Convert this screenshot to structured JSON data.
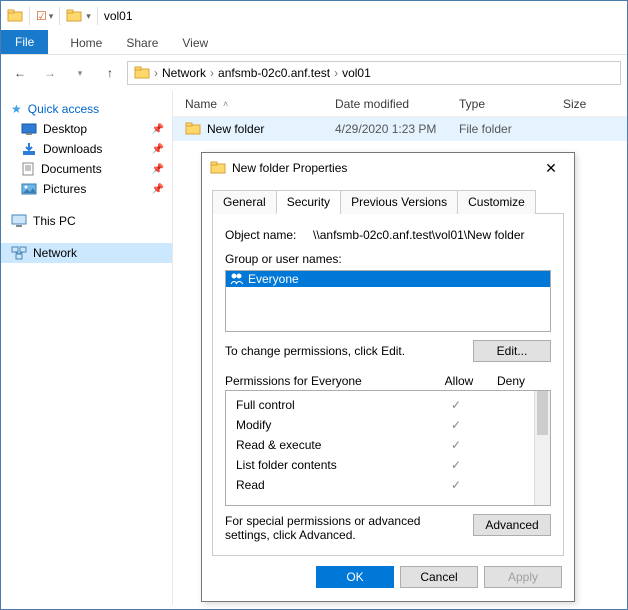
{
  "window": {
    "title": "vol01"
  },
  "qat": {
    "check": "☑",
    "dropdown": "▾"
  },
  "ribbon": {
    "file": "File",
    "home": "Home",
    "share": "Share",
    "view": "View"
  },
  "breadcrumb": {
    "root": "Network",
    "host": "anfsmb-02c0.anf.test",
    "folder": "vol01"
  },
  "columns": {
    "name": "Name",
    "date": "Date modified",
    "type": "Type",
    "size": "Size"
  },
  "row": {
    "name": "New folder",
    "date": "4/29/2020 1:23 PM",
    "type": "File folder"
  },
  "sidebar": {
    "quick": "Quick access",
    "items": [
      {
        "label": "Desktop"
      },
      {
        "label": "Downloads"
      },
      {
        "label": "Documents"
      },
      {
        "label": "Pictures"
      }
    ],
    "thispc": "This PC",
    "network": "Network"
  },
  "dialog": {
    "title": "New folder Properties",
    "tabs": {
      "general": "General",
      "security": "Security",
      "prev": "Previous Versions",
      "custom": "Customize"
    },
    "object_label": "Object name:",
    "object_value": "\\\\anfsmb-02c0.anf.test\\vol01\\New folder",
    "group_label": "Group or user names:",
    "group_selected": "Everyone",
    "edit_hint": "To change permissions, click Edit.",
    "edit_btn": "Edit...",
    "perm_header": "Permissions for Everyone",
    "allow": "Allow",
    "deny": "Deny",
    "perms": [
      {
        "label": "Full control"
      },
      {
        "label": "Modify"
      },
      {
        "label": "Read & execute"
      },
      {
        "label": "List folder contents"
      },
      {
        "label": "Read"
      }
    ],
    "adv_hint": "For special permissions or advanced settings, click Advanced.",
    "adv_btn": "Advanced",
    "ok": "OK",
    "cancel": "Cancel",
    "apply": "Apply"
  }
}
